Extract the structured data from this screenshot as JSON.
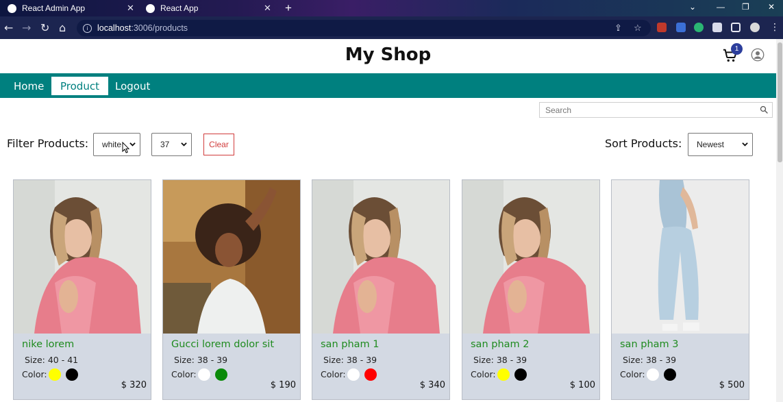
{
  "browser": {
    "tabs": [
      {
        "title": "React Admin App"
      },
      {
        "title": "React App"
      }
    ],
    "url_host": "localhost",
    "url_path": ":3006/products"
  },
  "shop": {
    "title": "My Shop",
    "cart_count": "1"
  },
  "nav": {
    "items": [
      {
        "label": "Home"
      },
      {
        "label": "Product"
      },
      {
        "label": "Logout"
      }
    ]
  },
  "search": {
    "placeholder": "Search"
  },
  "filter": {
    "label": "Filter Products:",
    "color_value": "white",
    "size_value": "37",
    "clear_label": "Clear"
  },
  "sort": {
    "label": "Sort Products:",
    "value": "Newest"
  },
  "products": [
    {
      "name": "nike lorem",
      "size": "Size: 40 - 41",
      "color_label": "Color:",
      "colors": [
        "#ffff00",
        "#000000"
      ],
      "price": "$ 320"
    },
    {
      "name": "Gucci lorem dolor sit",
      "size": "Size: 38 - 39",
      "color_label": "Color:",
      "colors": [
        "#ffffff",
        "#0a8a0a"
      ],
      "price": "$ 190"
    },
    {
      "name": "san pham 1",
      "size": "Size: 38 - 39",
      "color_label": "Color:",
      "colors": [
        "#ffffff",
        "#ff0000"
      ],
      "price": "$ 340"
    },
    {
      "name": "san pham 2",
      "size": "Size: 38 - 39",
      "color_label": "Color:",
      "colors": [
        "#ffff00",
        "#000000"
      ],
      "price": "$ 100"
    },
    {
      "name": "san pham 3",
      "size": "Size: 38 - 39",
      "color_label": "Color:",
      "colors": [
        "#ffffff",
        "#000000"
      ],
      "price": "$ 500"
    }
  ],
  "colors": {
    "nav_bg": "#00807f",
    "product_name": "#1f8b1f",
    "card_bg": "#d3d9e3",
    "clear_button": "#d13b3b"
  }
}
